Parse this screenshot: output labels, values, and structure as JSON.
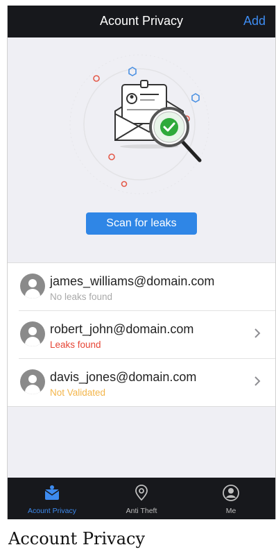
{
  "header": {
    "title": "Acount Privacy",
    "add_label": "Add"
  },
  "scan": {
    "button_label": "Scan for leaks"
  },
  "accounts": [
    {
      "email": "james_williams@domain.com",
      "status": "No leaks found",
      "status_type": "ok",
      "has_chevron": false
    },
    {
      "email": "robert_john@domain.com",
      "status": "Leaks found",
      "status_type": "leak",
      "has_chevron": true
    },
    {
      "email": "davis_jones@domain.com",
      "status": "Not Validated",
      "status_type": "pending",
      "has_chevron": true
    }
  ],
  "tabs": [
    {
      "label": "Acount Privacy",
      "icon": "privacy-icon",
      "active": true
    },
    {
      "label": "Anti Theft",
      "icon": "location-pin-icon",
      "active": false
    },
    {
      "label": "Me",
      "icon": "user-circle-icon",
      "active": false
    }
  ],
  "caption": "Account Privacy",
  "colors": {
    "accent": "#2f86e6",
    "leak": "#e64535",
    "pending": "#f3b54a",
    "bar": "#17181c"
  }
}
